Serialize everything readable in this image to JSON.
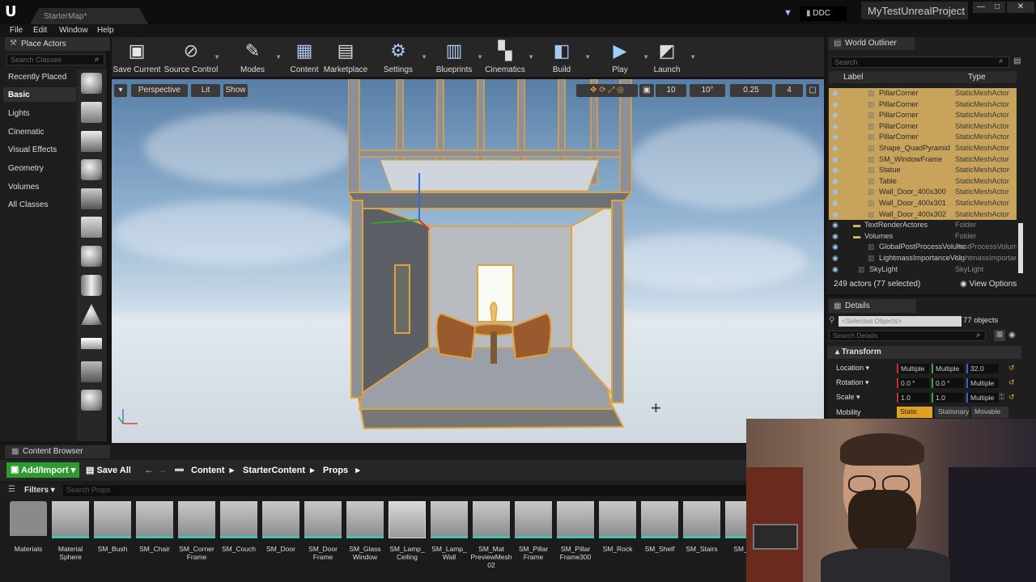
{
  "window": {
    "logo": "U",
    "map_tab": "StarterMap*",
    "ddc": "DDC",
    "project": "MyTestUnrealProject",
    "controls": [
      "—",
      "□",
      "✕"
    ]
  },
  "menu": [
    "File",
    "Edit",
    "Window",
    "Help"
  ],
  "place_actors": {
    "tab": "Place Actors",
    "search_placeholder": "Search Classes",
    "categories": [
      "Recently Placed",
      "Basic",
      "Lights",
      "Cinematic",
      "Visual Effects",
      "Geometry",
      "Volumes",
      "All Classes"
    ]
  },
  "toolbar": {
    "buttons": [
      {
        "label": "Save Current",
        "icon": "save-icon"
      },
      {
        "label": "Source Control",
        "icon": "source-control-icon"
      },
      {
        "label": "Modes",
        "icon": "modes-icon"
      },
      {
        "label": "Content",
        "icon": "content-icon"
      },
      {
        "label": "Marketplace",
        "icon": "marketplace-icon"
      },
      {
        "label": "Settings",
        "icon": "settings-icon"
      },
      {
        "label": "Blueprints",
        "icon": "blueprints-icon"
      },
      {
        "label": "Cinematics",
        "icon": "cinematics-icon"
      },
      {
        "label": "Build",
        "icon": "build-icon"
      },
      {
        "label": "Play",
        "icon": "play-icon"
      },
      {
        "label": "Launch",
        "icon": "launch-icon"
      }
    ]
  },
  "viewport": {
    "perspective": "Perspective",
    "lit": "Lit",
    "show": "Show",
    "grid_snap": "10",
    "rotation_snap": "10°",
    "scale_snap": "0.25",
    "camera_speed": "4"
  },
  "outliner": {
    "tab": "World Outliner",
    "search_placeholder": "Search",
    "col_label": "Label",
    "col_type": "Type",
    "rows": [
      {
        "label": "PillarCorner",
        "type": "StaticMeshActor",
        "selected": true
      },
      {
        "label": "PillarCorner",
        "type": "StaticMeshActor",
        "selected": true
      },
      {
        "label": "PillarCorner",
        "type": "StaticMeshActor",
        "selected": true
      },
      {
        "label": "PillarCorner",
        "type": "StaticMeshActor",
        "selected": true
      },
      {
        "label": "PillarCorner",
        "type": "StaticMeshActor",
        "selected": true
      },
      {
        "label": "Shape_QuadPyramid",
        "type": "StaticMeshActor",
        "selected": true
      },
      {
        "label": "SM_WindowFrame",
        "type": "StaticMeshActor",
        "selected": true
      },
      {
        "label": "Statue",
        "type": "StaticMeshActor",
        "selected": true
      },
      {
        "label": "Table",
        "type": "StaticMeshActor",
        "selected": true
      },
      {
        "label": "Wall_Door_400x300",
        "type": "StaticMeshActor",
        "selected": true
      },
      {
        "label": "Wall_Door_400x301",
        "type": "StaticMeshActor",
        "selected": true
      },
      {
        "label": "Wall_Door_400x302",
        "type": "StaticMeshActor",
        "selected": true
      },
      {
        "label": "TextRenderActores",
        "type": "Folder",
        "selected": false
      },
      {
        "label": "Volumes",
        "type": "Folder",
        "selected": false
      },
      {
        "label": "GlobalPostProcessVolume",
        "type": "PostProcessVolume",
        "selected": false
      },
      {
        "label": "LightmassImportanceVolume",
        "type": "LightmassImportanceVolume",
        "selected": false
      },
      {
        "label": "SkyLight",
        "type": "SkyLight",
        "selected": false
      }
    ],
    "status": "249 actors (77 selected)",
    "view_options": "View Options"
  },
  "details": {
    "tab": "Details",
    "selected_placeholder": "<Selected Objects>",
    "count": "77 objects",
    "search_placeholder": "Search Details",
    "transform": "Transform",
    "location_label": "Location",
    "location": [
      "Multiple",
      "Multiple",
      "32.0"
    ],
    "rotation_label": "Rotation",
    "rotation": [
      "0.0 °",
      "0.0 °",
      "Multiple"
    ],
    "scale_label": "Scale",
    "scale": [
      "1.0",
      "1.0",
      "Multiple"
    ],
    "mobility_label": "Mobility",
    "mobility": [
      "Static",
      "Stationary",
      "Movable"
    ]
  },
  "content_browser": {
    "tab": "Content Browser",
    "add_import": "Add/Import",
    "save_all": "Save All",
    "path": [
      "Content",
      "StarterContent",
      "Props"
    ],
    "filters": "Filters",
    "search_placeholder": "Search Props",
    "assets": [
      "Materials",
      "Material Sphere",
      "SM_Bush",
      "SM_Chair",
      "SM_Corner Frame",
      "SM_Couch",
      "SM_Door",
      "SM_Door Frame",
      "SM_Glass Window",
      "SM_Lamp_ Ceiling",
      "SM_Lamp_ Wall",
      "SM_Mat PreviewMesh 02",
      "SM_Pillar Frame",
      "SM_Pillar Frame300",
      "SM_Rock",
      "SM_Shelf",
      "SM_Stairs",
      "SM_St"
    ]
  }
}
